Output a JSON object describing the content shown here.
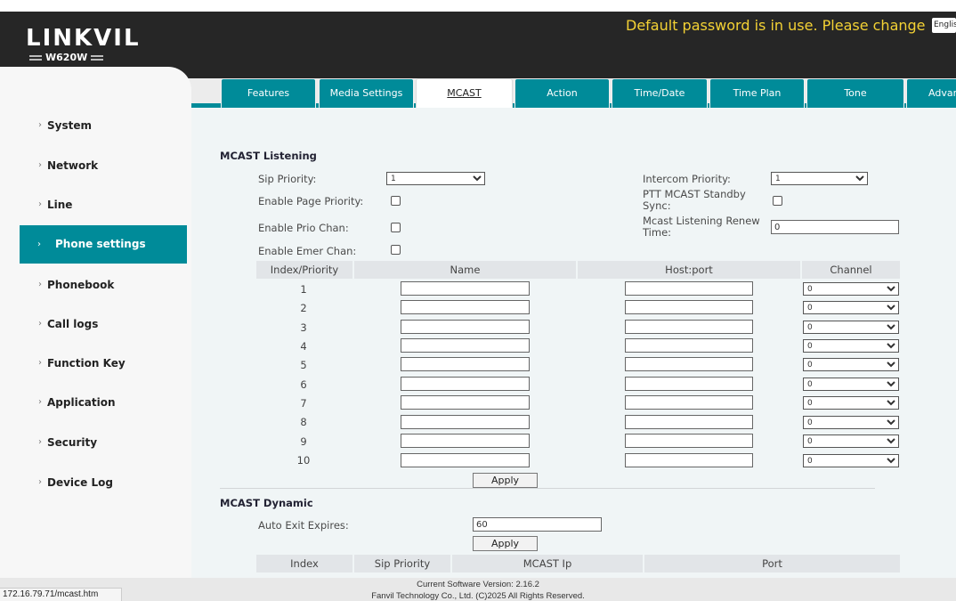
{
  "header": {
    "logo": "LINKVIL",
    "model": "W620W",
    "warning": "Default password is in use. Please change",
    "language": "English"
  },
  "tabs": [
    "Features",
    "Media Settings",
    "MCAST",
    "Action",
    "Time/Date",
    "Time Plan",
    "Tone",
    "Advanced"
  ],
  "sidebar": {
    "items": [
      "System",
      "Network",
      "Line",
      "Phone settings",
      "Phonebook",
      "Call logs",
      "Function Key",
      "Application",
      "Security",
      "Device Log"
    ],
    "active": "Phone settings"
  },
  "listening": {
    "title": "MCAST Listening",
    "sip_priority_label": "Sip Priority:",
    "sip_priority_value": "1",
    "intercom_priority_label": "Intercom Priority:",
    "intercom_priority_value": "1",
    "enable_page_priority_label": "Enable Page Priority:",
    "ptt_standby_label_1": "PTT MCAST Standby",
    "ptt_standby_label_2": "Sync:",
    "enable_prio_chan_label": "Enable Prio Chan:",
    "renew_label_1": "Mcast Listening Renew",
    "renew_label_2": "Time:",
    "renew_value": "0",
    "enable_emer_chan_label": "Enable Emer Chan:",
    "table_headers": [
      "Index/Priority",
      "Name",
      "Host:port",
      "Channel"
    ],
    "rows": [
      {
        "index": "1",
        "channel": "0"
      },
      {
        "index": "2",
        "channel": "0"
      },
      {
        "index": "3",
        "channel": "0"
      },
      {
        "index": "4",
        "channel": "0"
      },
      {
        "index": "5",
        "channel": "0"
      },
      {
        "index": "6",
        "channel": "0"
      },
      {
        "index": "7",
        "channel": "0"
      },
      {
        "index": "8",
        "channel": "0"
      },
      {
        "index": "9",
        "channel": "0"
      },
      {
        "index": "10",
        "channel": "0"
      }
    ],
    "apply_label": "Apply"
  },
  "dynamic": {
    "title": "MCAST Dynamic",
    "auto_exit_label": "Auto Exit Expires:",
    "auto_exit_value": "60",
    "apply_label": "Apply",
    "table_headers": [
      "Index",
      "Sip Priority",
      "MCAST Ip",
      "Port"
    ]
  },
  "footer": {
    "version": "Current Software Version: 2.16.2",
    "copyright": "Fanvil Technology Co., Ltd. (C)2025 All Rights Reserved.",
    "status_url": "172.16.79.71/mcast.htm"
  },
  "colors": {
    "teal": "#008b99",
    "header_bg": "#262626",
    "warning": "#f4d234"
  }
}
